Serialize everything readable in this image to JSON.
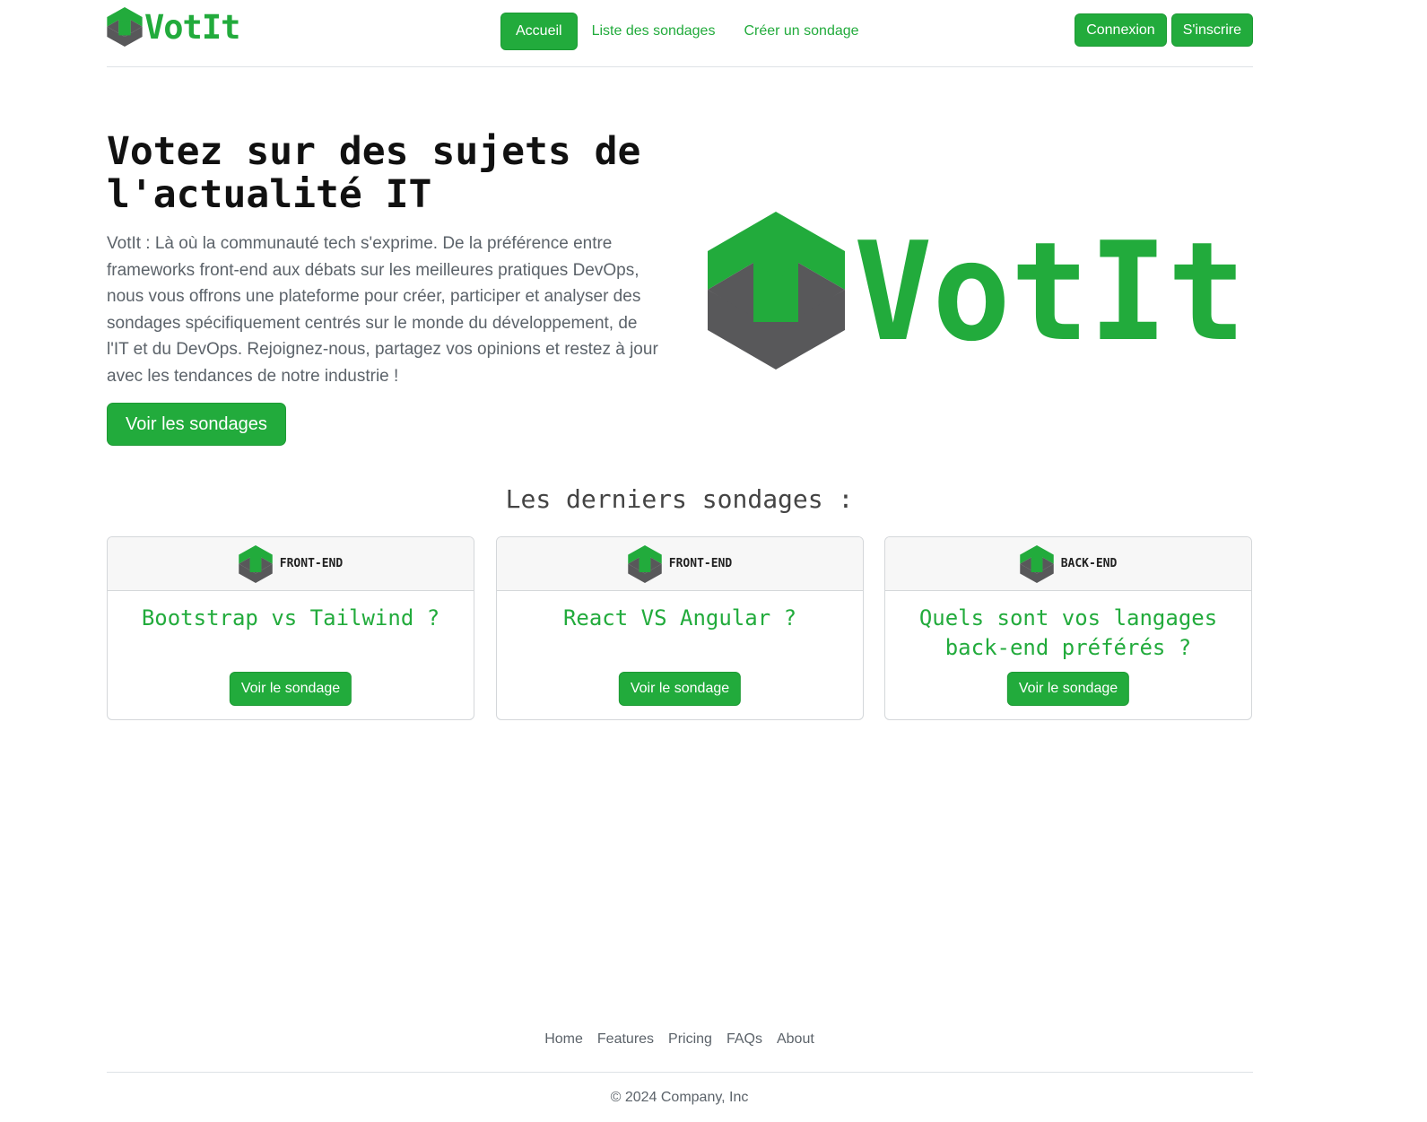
{
  "colors": {
    "brand_green": "#22ab3c",
    "brand_gray": "#58585a"
  },
  "brand": {
    "name": "VotIt",
    "logo_icon": "votit-hexagon-arrow-icon"
  },
  "nav": {
    "items": [
      {
        "label": "Accueil",
        "active": true
      },
      {
        "label": "Liste des sondages",
        "active": false
      },
      {
        "label": "Créer un sondage",
        "active": false
      }
    ]
  },
  "auth": {
    "login_label": "Connexion",
    "signup_label": "S'inscrire"
  },
  "hero": {
    "title": "Votez sur des sujets de l'actualité IT",
    "text": "VotIt : Là où la communauté tech s'exprime. De la préférence entre frameworks front-end aux débats sur les meilleures pratiques DevOps, nous vous offrons une plateforme pour créer, participer et analyser des sondages spécifiquement centrés sur le monde du développement, de l'IT et du DevOps. Rejoignez-nous, partagez vos opinions et restez à jour avec les tendances de notre industrie !",
    "button_label": "Voir les sondages",
    "logo_text": "VotIt"
  },
  "latest": {
    "title": "Les derniers sondages :",
    "polls": [
      {
        "category": "FRONT-END",
        "title": "Bootstrap vs Tailwind ?",
        "button_label": "Voir le sondage"
      },
      {
        "category": "FRONT-END",
        "title": "React VS Angular ?",
        "button_label": "Voir le sondage"
      },
      {
        "category": "BACK-END",
        "title": "Quels sont vos langages back-end préférés ?",
        "button_label": "Voir le sondage"
      }
    ]
  },
  "footer": {
    "links": [
      "Home",
      "Features",
      "Pricing",
      "FAQs",
      "About"
    ],
    "copyright": "© 2024 Company, Inc"
  }
}
